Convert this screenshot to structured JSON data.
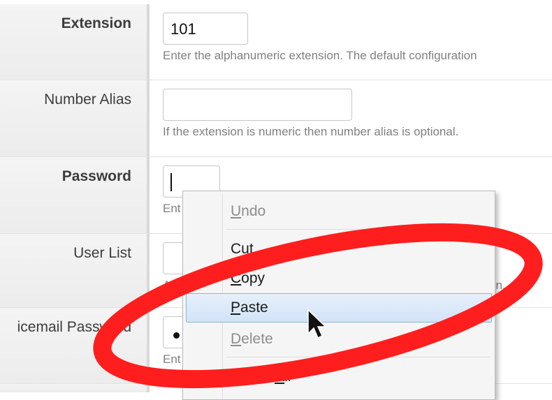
{
  "form": {
    "rows": [
      {
        "label": "Extension",
        "value": "101",
        "help": "Enter the alphanumeric extension. The default configuration"
      },
      {
        "label": "Number Alias",
        "value": "",
        "help": "If the extension is numeric then number alias is optional."
      },
      {
        "label": "Password",
        "value": "",
        "help": "Ent"
      },
      {
        "label": "User List",
        "value": "",
        "help": "As",
        "help_tail": "on."
      },
      {
        "label": "icemail Password",
        "value": "",
        "help": "Ent"
      }
    ]
  },
  "context_menu": {
    "items": [
      {
        "label": "Undo",
        "mnemonic": "U",
        "enabled": false
      },
      {
        "label": "Cut",
        "mnemonic": "t",
        "enabled": true
      },
      {
        "label": "Copy",
        "mnemonic": "C",
        "enabled": true
      },
      {
        "label": "Paste",
        "mnemonic": "P",
        "enabled": true,
        "highlighted": true
      },
      {
        "label": "Delete",
        "mnemonic": "D",
        "enabled": false
      },
      {
        "label": "Select All",
        "mnemonic": "A",
        "enabled": true
      }
    ]
  },
  "colors": {
    "annotation_ring": "#ff1e1e",
    "menu_highlight": "#d2e3f7",
    "menu_highlight_border": "#89b3e3"
  },
  "icons": {
    "cursor": "arrow-pointer-icon",
    "annotation": "red-ellipse-annotation"
  }
}
